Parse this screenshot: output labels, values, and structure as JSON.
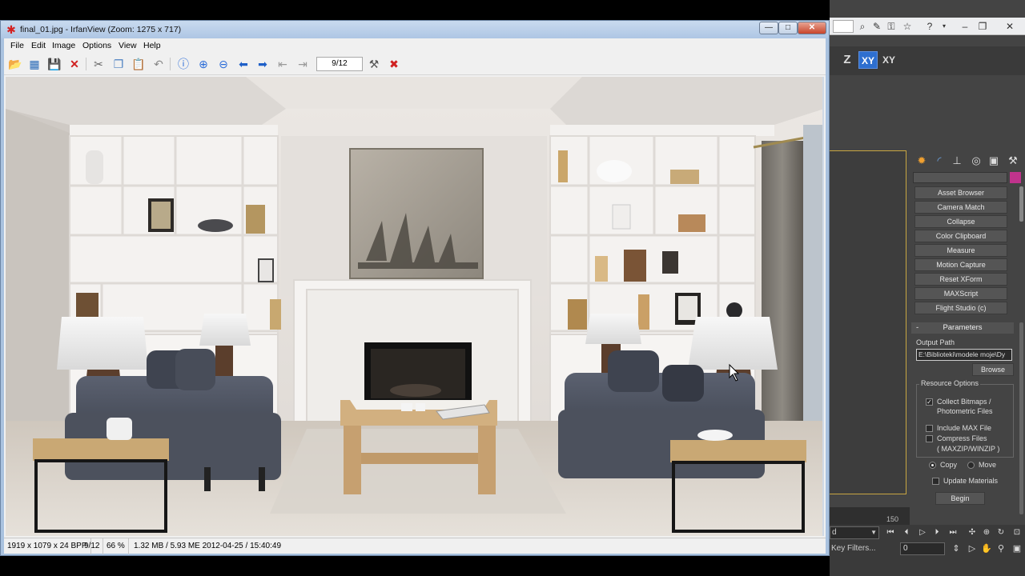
{
  "irfan": {
    "title": "final_01.jpg - IrfanView (Zoom: 1275 x 717)",
    "window_buttons": {
      "minimize": "—",
      "maximize": "□",
      "close": "✕"
    },
    "menu": [
      "File",
      "Edit",
      "Image",
      "Options",
      "View",
      "Help"
    ],
    "toolbar_icons": [
      "open-icon",
      "thumbnails-icon",
      "save-icon",
      "delete-icon",
      "cut-icon",
      "copy-icon",
      "paste-icon",
      "undo-icon",
      "info-icon",
      "zoom-in-icon",
      "zoom-out-icon",
      "previous-icon",
      "next-icon",
      "first-page-icon",
      "last-page-icon",
      "properties-icon",
      "exit-icon"
    ],
    "page_indicator": "9/12",
    "status": {
      "dimensions": "1919 x 1079 x 24 BPP",
      "index": "9/12",
      "zoom": "66 %",
      "fileinfo": "1.32 MB / 5.93 ME 2012-04-25 / 15:40:49"
    }
  },
  "max": {
    "axis": {
      "z": "Z",
      "xy": "XY",
      "xyz": "XY"
    },
    "utilities": [
      "Asset Browser",
      "Camera Match",
      "Collapse",
      "Color Clipboard",
      "Measure",
      "Motion Capture",
      "Reset XForm",
      "MAXScript",
      "Flight Studio (c)"
    ],
    "parameters": {
      "header": "Parameters",
      "output_label": "Output Path",
      "output_value": "E:\\Biblioteki\\modele moje\\Dy",
      "browse": "Browse",
      "resource_title": "Resource Options",
      "collect_bitmaps": "Collect Bitmaps / Photometric Files",
      "include_max": "Include MAX File",
      "compress": "Compress Files",
      "compress_sub": "( MAXZIP/WINZIP )",
      "copy": "Copy",
      "move": "Move",
      "update_materials": "Update Materials",
      "begin": "Begin"
    },
    "timeline_value": "150",
    "key_filters": "Key Filters...",
    "frame_value": "0",
    "selection_tail": "d"
  },
  "colors": {
    "accent_xy": "#2e6fcf",
    "object_color": "#c0338c",
    "viewport_border": "#c8a642",
    "irfan_close": "#c8452b"
  }
}
